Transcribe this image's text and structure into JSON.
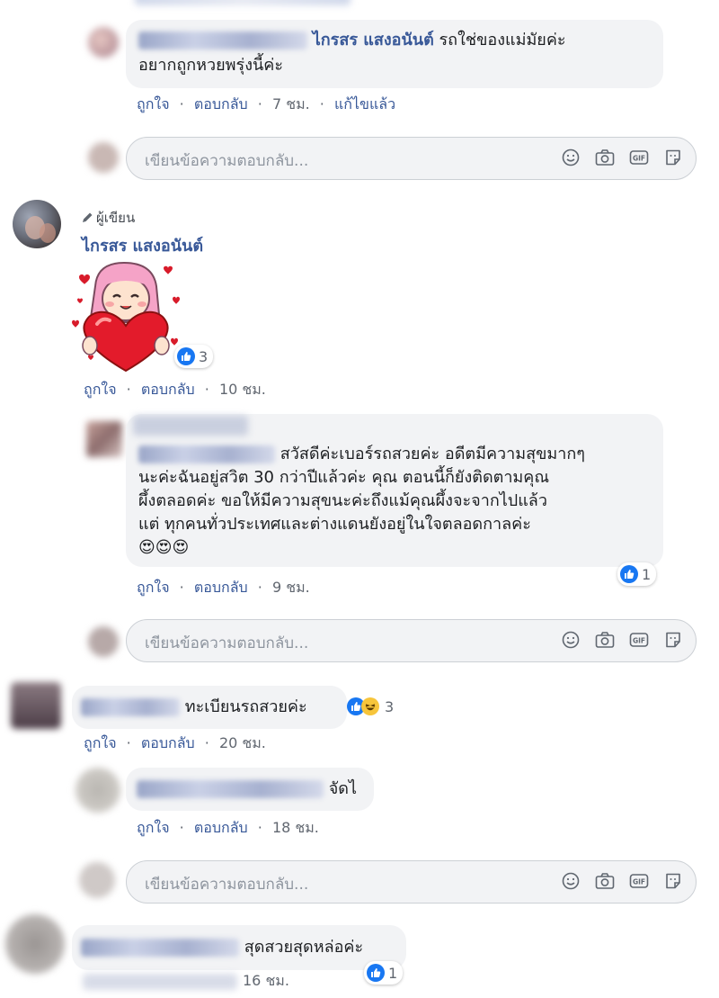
{
  "thread": {
    "top_fragment": {
      "time_label": "10 ชม."
    },
    "reply1": {
      "author": "ไกรสร แสงอนันต์",
      "text_line1": "รถใช่ของแม่มัยค่ะ",
      "text_line2": "อยากถูกหวยพรุ่งนี้ค่ะ",
      "like": "ถูกใจ",
      "reply": "ตอบกลับ",
      "time": "7 ชม.",
      "edited": "แก้ไขแล้ว"
    },
    "reply_box_placeholder": "เขียนข้อความตอบกลับ...",
    "comment_author": {
      "badge": "ผู้เขียน",
      "name": "ไกรสร แสงอนันต์",
      "reaction_count": "3",
      "like": "ถูกใจ",
      "reply": "ตอบกลับ",
      "time": "10 ชม."
    },
    "reply2": {
      "line1": "สวัสดีค่ะเบอร์รถสวยค่ะ อดีตมีความสุขมากๆ",
      "line2": "นะค่ะฉันอยู่สวิต 30 กว่าปีแล้วค่ะ คุณ ตอนนี้ก็ยังติดตามคุณ",
      "line3": "ผึ้งตลอดค่ะ ขอให้มีความสุขนะค่ะถึงแม้คุณผึ้งจะจากไปแล้ว",
      "line4": "แต่ ทุกคนทั่วประเทศและต่างแดนยังอยู่ในใจตลอดกาลค่ะ",
      "emoji": "😍😍😍",
      "reaction_count": "1",
      "like": "ถูกใจ",
      "reply": "ตอบกลับ",
      "time": "9 ชม."
    },
    "comment3": {
      "text": "ทะเบียนรถสวยค่ะ",
      "reaction_count": "3",
      "like": "ถูกใจ",
      "reply": "ตอบกลับ",
      "time": "20 ชม."
    },
    "reply3": {
      "text": "จัดไ",
      "like": "ถูกใจ",
      "reply": "ตอบกลับ",
      "time": "18 ชม."
    },
    "comment4": {
      "text": "สุดสวยสุดหล่อค่ะ",
      "reaction_count": "1",
      "time": "16 ชม."
    },
    "separator": "·"
  },
  "colors": {
    "link": "#385898",
    "like_blue": "#1877f2",
    "bubble": "#f2f3f5",
    "meta_gray": "#616770"
  },
  "icons": [
    "emoji-icon",
    "camera-icon",
    "gif-icon",
    "sticker-icon",
    "pencil-icon",
    "like-icon",
    "haha-icon"
  ]
}
